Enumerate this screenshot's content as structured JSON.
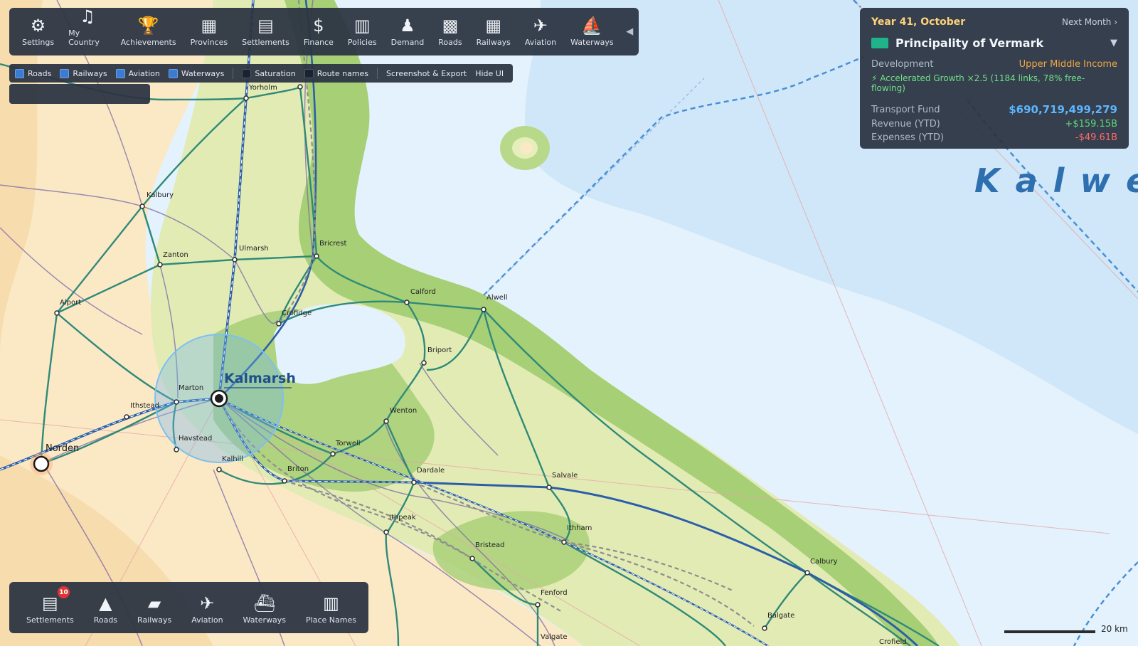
{
  "toolbar": {
    "items": [
      {
        "label": "Settings",
        "icon": "gear-icon",
        "glyph": "⚙"
      },
      {
        "label": "My Country",
        "icon": "country-icon",
        "glyph": "♫"
      },
      {
        "label": "Achievements",
        "icon": "trophy-icon",
        "glyph": "🏆"
      },
      {
        "label": "Provinces",
        "icon": "provinces-icon",
        "glyph": "▦"
      },
      {
        "label": "Settlements",
        "icon": "settlements-icon",
        "glyph": "▤"
      },
      {
        "label": "Finance",
        "icon": "finance-icon",
        "glyph": "$"
      },
      {
        "label": "Policies",
        "icon": "policies-icon",
        "glyph": "▥"
      },
      {
        "label": "Demand",
        "icon": "demand-icon",
        "glyph": "♟"
      },
      {
        "label": "Roads",
        "icon": "roads-icon",
        "glyph": "▩"
      },
      {
        "label": "Railways",
        "icon": "railways-icon",
        "glyph": "▦"
      },
      {
        "label": "Aviation",
        "icon": "aviation-icon",
        "glyph": "✈"
      },
      {
        "label": "Waterways",
        "icon": "waterways-icon",
        "glyph": "⛵"
      }
    ],
    "collapse_glyph": "◀"
  },
  "layers": {
    "checkboxes": [
      {
        "label": "Roads",
        "checked": true
      },
      {
        "label": "Railways",
        "checked": true
      },
      {
        "label": "Aviation",
        "checked": true
      },
      {
        "label": "Waterways",
        "checked": true
      },
      {
        "label": "Saturation",
        "checked": false
      },
      {
        "label": "Route names",
        "checked": false
      }
    ],
    "screenshot_label": "Screenshot & Export",
    "hide_ui_label": "Hide UI"
  },
  "info": {
    "date": "Year 41, October",
    "next_month": "Next Month ›",
    "country": "Principality of Vermark",
    "flag_color": "#1fb38a",
    "dropdown_glyph": "▼",
    "development_label": "Development",
    "development_value": "Upper Middle Income",
    "growth": "⚡ Accelerated Growth ×2.5 (1184 links, 78% free-flowing)",
    "fund_label": "Transport Fund",
    "fund_value": "$690,719,499,279",
    "revenue_label": "Revenue (YTD)",
    "revenue_value": "+$159.15B",
    "expenses_label": "Expenses (YTD)",
    "expenses_value": "-$49.61B"
  },
  "bottom": {
    "items": [
      {
        "label": "Settlements",
        "icon": "settlements-icon",
        "glyph": "▤"
      },
      {
        "label": "Roads",
        "icon": "road-icon",
        "glyph": "▲"
      },
      {
        "label": "Railways",
        "icon": "train-icon",
        "glyph": "▰"
      },
      {
        "label": "Aviation",
        "icon": "plane-icon",
        "glyph": "✈"
      },
      {
        "label": "Waterways",
        "icon": "ship-icon",
        "glyph": "⛴"
      },
      {
        "label": "Place Names",
        "icon": "place-names-icon",
        "glyph": "▥"
      }
    ],
    "settlements_badge": "10"
  },
  "map": {
    "sea_name": "Kalwel",
    "capital": "Kalmarsh",
    "places": {
      "yorholm": "Yorholm",
      "kalbury": "Kalbury",
      "zanton": "Zanton",
      "ulmarsh": "Ulmarsh",
      "bricrest": "Bricrest",
      "alport": "Alport",
      "crofidge": "Crofidge",
      "calford": "Calford",
      "alwell": "Alwell",
      "briport": "Briport",
      "marton": "Marton",
      "ithstead": "Ithstead",
      "norden": "Norden",
      "havstead": "Havstead",
      "kalhill": "Kalhill",
      "wenton": "Wenton",
      "torwell": "Torwell",
      "briton": "Briton",
      "dardale": "Dardale",
      "salvale": "Salvale",
      "ithpeak": "Ithpeak",
      "ithham": "Ithham",
      "bristead": "Bristead",
      "fenford": "Fenford",
      "valgate": "Valgate",
      "calbury": "Calbury",
      "balgate": "Balgate",
      "crofield": "Crofield"
    },
    "scale_label": "20 km"
  }
}
